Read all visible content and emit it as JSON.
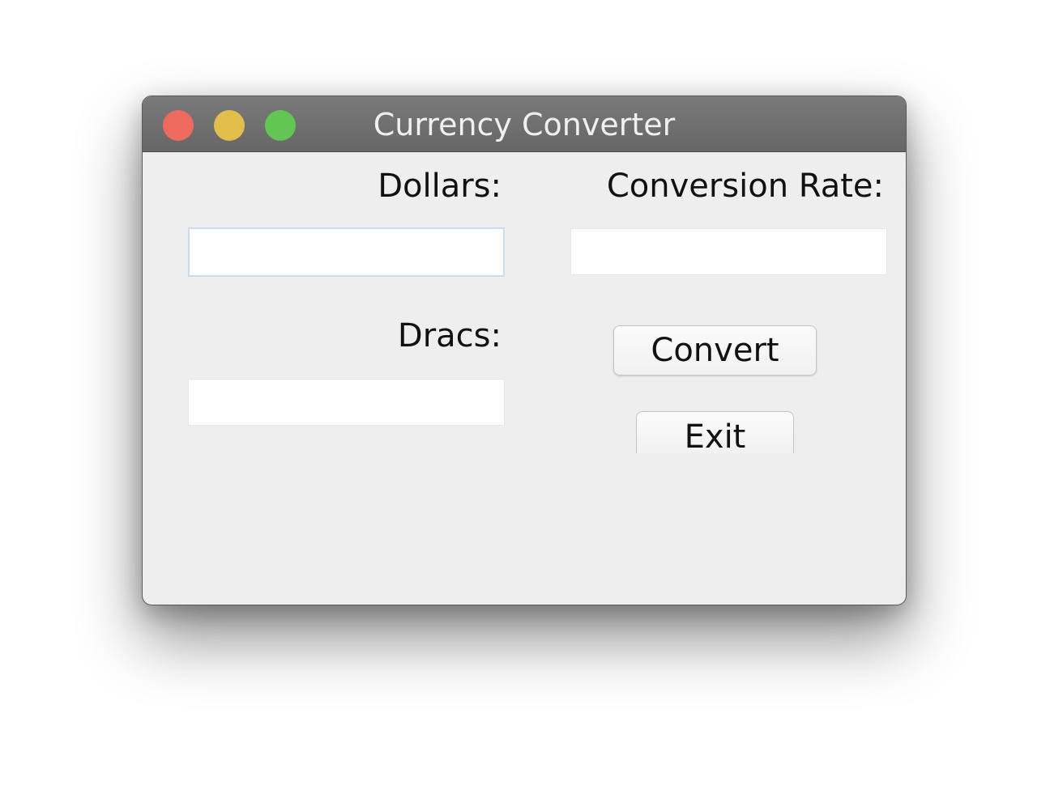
{
  "window": {
    "title": "Currency Converter"
  },
  "form": {
    "dollars_label": "Dollars:",
    "dollars_value": "",
    "rate_label": "Conversion Rate:",
    "rate_value": "",
    "dracs_label": "Dracs:",
    "dracs_value": ""
  },
  "buttons": {
    "convert_label": "Convert",
    "exit_label": "Exit"
  },
  "colors": {
    "close": "#ed6a5e",
    "minimize": "#e2be4a",
    "maximize": "#62c554"
  }
}
